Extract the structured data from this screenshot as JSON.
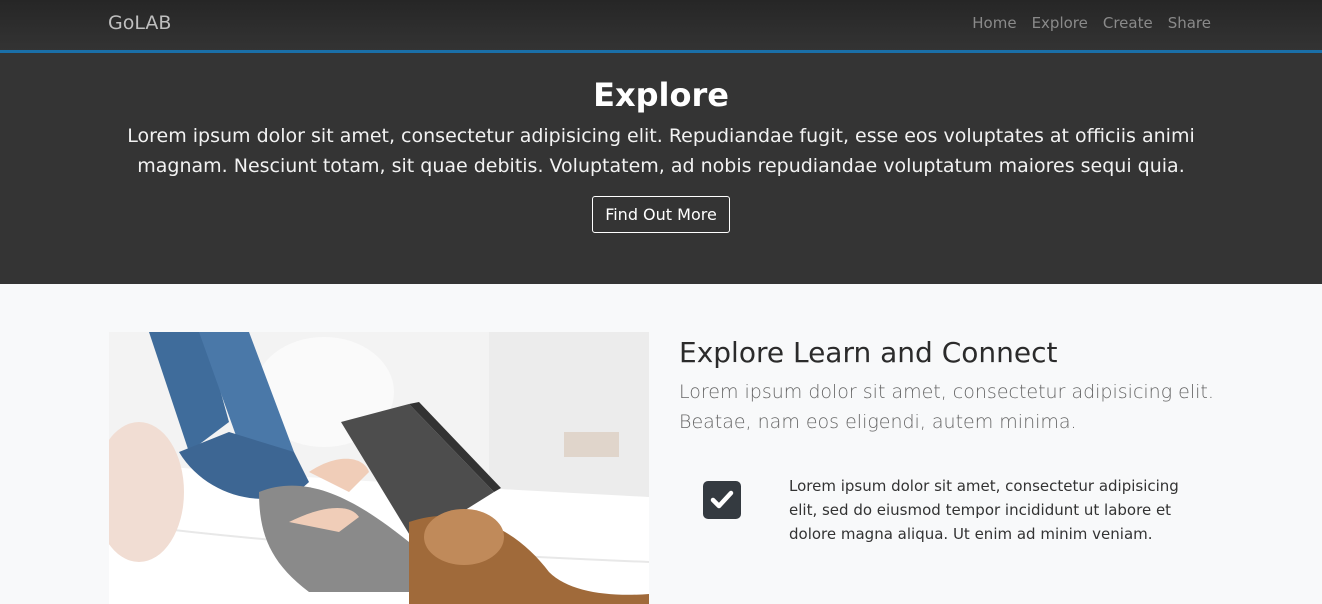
{
  "navbar": {
    "brand": "GoLAB",
    "links": [
      "Home",
      "Explore",
      "Create",
      "Share"
    ]
  },
  "hero": {
    "title": "Explore",
    "text": "Lorem ipsum dolor sit amet, consectetur adipisicing elit. Repudiandae fugit, esse eos voluptates at officiis animi magnam. Nesciunt totam, sit quae debitis. Voluptatem, ad nobis repudiandae voluptatum maiores sequi quia.",
    "button": "Find Out More"
  },
  "section": {
    "title": "Explore Learn and Connect",
    "lead": "Lorem ipsum dolor sit amet, consectetur adipisicing elit. Beatae, nam eos eligendi, autem minima.",
    "feature": {
      "icon": "check-square-icon",
      "text": "Lorem ipsum dolor sit amet, consectetur adipisicing elit, sed do eiusmod tempor incididunt ut labore et dolore magna aliqua. Ut enim ad minim veniam."
    },
    "image": "photo-woman-reading-book-on-bed"
  },
  "colors": {
    "navbar_border": "#1a6fa8",
    "hero_bg": "#343434",
    "page_bg": "#f8f9fa",
    "icon_bg": "#343a40"
  }
}
